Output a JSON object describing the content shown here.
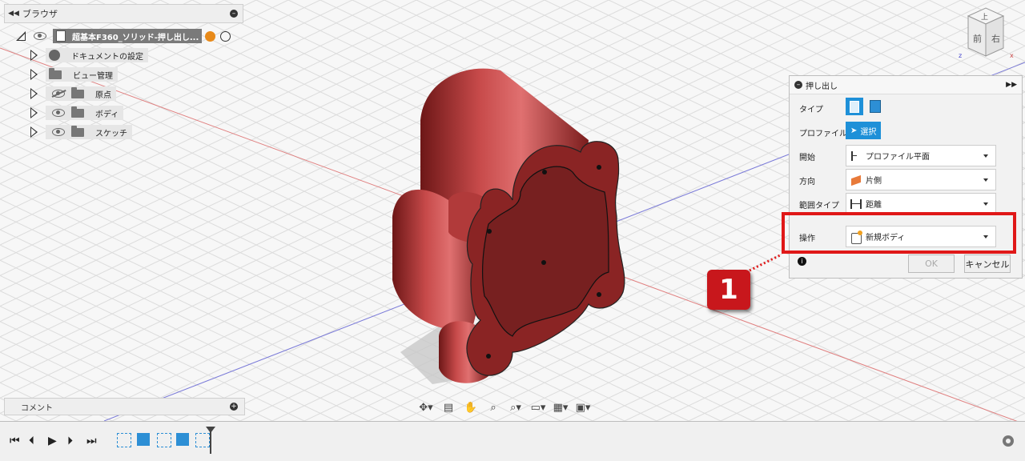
{
  "browser": {
    "title": "ブラウザ",
    "root_label": "超基本F360_ソリッド-押し出し...",
    "items": [
      {
        "label": "ドキュメントの設定",
        "icon": "gear-icon"
      },
      {
        "label": "ビュー管理",
        "icon": "folder-icon"
      },
      {
        "label": "原点",
        "icon": "folder-icon"
      },
      {
        "label": "ボディ",
        "icon": "folder-icon"
      },
      {
        "label": "スケッチ",
        "icon": "folder-icon"
      }
    ]
  },
  "comment": {
    "title": "コメント"
  },
  "viewcube": {
    "top_label": "上",
    "front_label": "前",
    "right_label": "右",
    "x_axis": "x",
    "z_axis": "z"
  },
  "dialog": {
    "title": "押し出し",
    "rows": {
      "type": {
        "label": "タイプ"
      },
      "profile": {
        "label": "プロファイル",
        "button": "選択"
      },
      "start": {
        "label": "開始",
        "value": "プロファイル平面"
      },
      "direction": {
        "label": "方向",
        "value": "片側"
      },
      "extent_type": {
        "label": "範囲タイプ",
        "value": "距離"
      },
      "operation": {
        "label": "操作",
        "value": "新規ボディ"
      }
    },
    "ok_label": "OK",
    "cancel_label": "キャンセル"
  },
  "callout": {
    "number": "1"
  },
  "colors": {
    "accent": "#1e90d8",
    "highlight": "#e01818",
    "body_red": "#9b2c2c"
  }
}
